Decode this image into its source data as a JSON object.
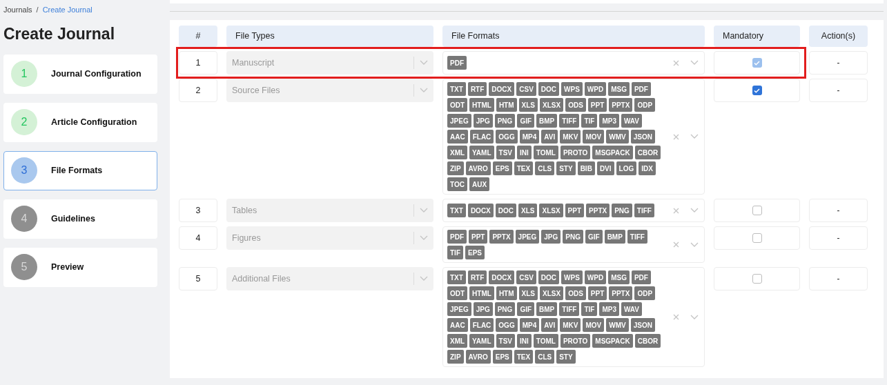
{
  "breadcrumb": {
    "separator": "/",
    "items": [
      {
        "label": "Journals",
        "current": false
      },
      {
        "label": "Create Journal",
        "current": true
      }
    ]
  },
  "title": "Create Journal",
  "steps": [
    {
      "number": "1",
      "label": "Journal Configuration",
      "kind": "done",
      "selected": false
    },
    {
      "number": "2",
      "label": "Article Configuration",
      "kind": "done",
      "selected": false
    },
    {
      "number": "3",
      "label": "File Formats",
      "kind": "active",
      "selected": true
    },
    {
      "number": "4",
      "label": "Guidelines",
      "kind": "pending",
      "selected": false
    },
    {
      "number": "5",
      "label": "Preview",
      "kind": "pending",
      "selected": false
    }
  ],
  "table": {
    "columns": [
      "#",
      "File Types",
      "File Formats",
      "Mandatory",
      "Action(s)"
    ],
    "rows": [
      {
        "number": "1",
        "file_type": "Manuscript",
        "formats": [
          "PDF"
        ],
        "mandatory": {
          "checked": true,
          "disabled": true
        },
        "action": "-",
        "highlighted": true
      },
      {
        "number": "2",
        "file_type": "Source Files",
        "formats": [
          "TXT",
          "RTF",
          "DOCX",
          "CSV",
          "DOC",
          "WPS",
          "WPD",
          "MSG",
          "PDF",
          "ODT",
          "HTML",
          "HTM",
          "XLS",
          "XLSX",
          "ODS",
          "PPT",
          "PPTX",
          "ODP",
          "JPEG",
          "JPG",
          "PNG",
          "GIF",
          "BMP",
          "TIFF",
          "TIF",
          "MP3",
          "WAV",
          "AAC",
          "FLAC",
          "OGG",
          "MP4",
          "AVI",
          "MKV",
          "MOV",
          "WMV",
          "JSON",
          "XML",
          "YAML",
          "TSV",
          "INI",
          "TOML",
          "PROTO",
          "MSGPACK",
          "CBOR",
          "ZIP",
          "AVRO",
          "EPS",
          "TEX",
          "CLS",
          "STY",
          "BIB",
          "DVI",
          "LOG",
          "IDX",
          "TOC",
          "AUX"
        ],
        "mandatory": {
          "checked": true,
          "disabled": false
        },
        "action": "-",
        "highlighted": false
      },
      {
        "number": "3",
        "file_type": "Tables",
        "formats": [
          "TXT",
          "DOCX",
          "DOC",
          "XLS",
          "XLSX",
          "PPT",
          "PPTX",
          "PNG",
          "TIFF"
        ],
        "mandatory": {
          "checked": false,
          "disabled": false
        },
        "action": "-",
        "highlighted": false
      },
      {
        "number": "4",
        "file_type": "Figures",
        "formats": [
          "PDF",
          "PPT",
          "PPTX",
          "JPEG",
          "JPG",
          "PNG",
          "GIF",
          "BMP",
          "TIFF",
          "TIF",
          "EPS"
        ],
        "mandatory": {
          "checked": false,
          "disabled": false
        },
        "action": "-",
        "highlighted": false
      },
      {
        "number": "5",
        "file_type": "Additional Files",
        "formats": [
          "TXT",
          "RTF",
          "DOCX",
          "CSV",
          "DOC",
          "WPS",
          "WPD",
          "MSG",
          "PDF",
          "ODT",
          "HTML",
          "HTM",
          "XLS",
          "XLSX",
          "ODS",
          "PPT",
          "PPTX",
          "ODP",
          "JPEG",
          "JPG",
          "PNG",
          "GIF",
          "BMP",
          "TIFF",
          "TIF",
          "MP3",
          "WAV",
          "AAC",
          "FLAC",
          "OGG",
          "MP4",
          "AVI",
          "MKV",
          "MOV",
          "WMV",
          "JSON",
          "XML",
          "YAML",
          "TSV",
          "INI",
          "TOML",
          "PROTO",
          "MSGPACK",
          "CBOR",
          "ZIP",
          "AVRO",
          "EPS",
          "TEX",
          "CLS",
          "STY"
        ],
        "mandatory": {
          "checked": false,
          "disabled": false
        },
        "action": "-",
        "highlighted": false
      }
    ]
  }
}
